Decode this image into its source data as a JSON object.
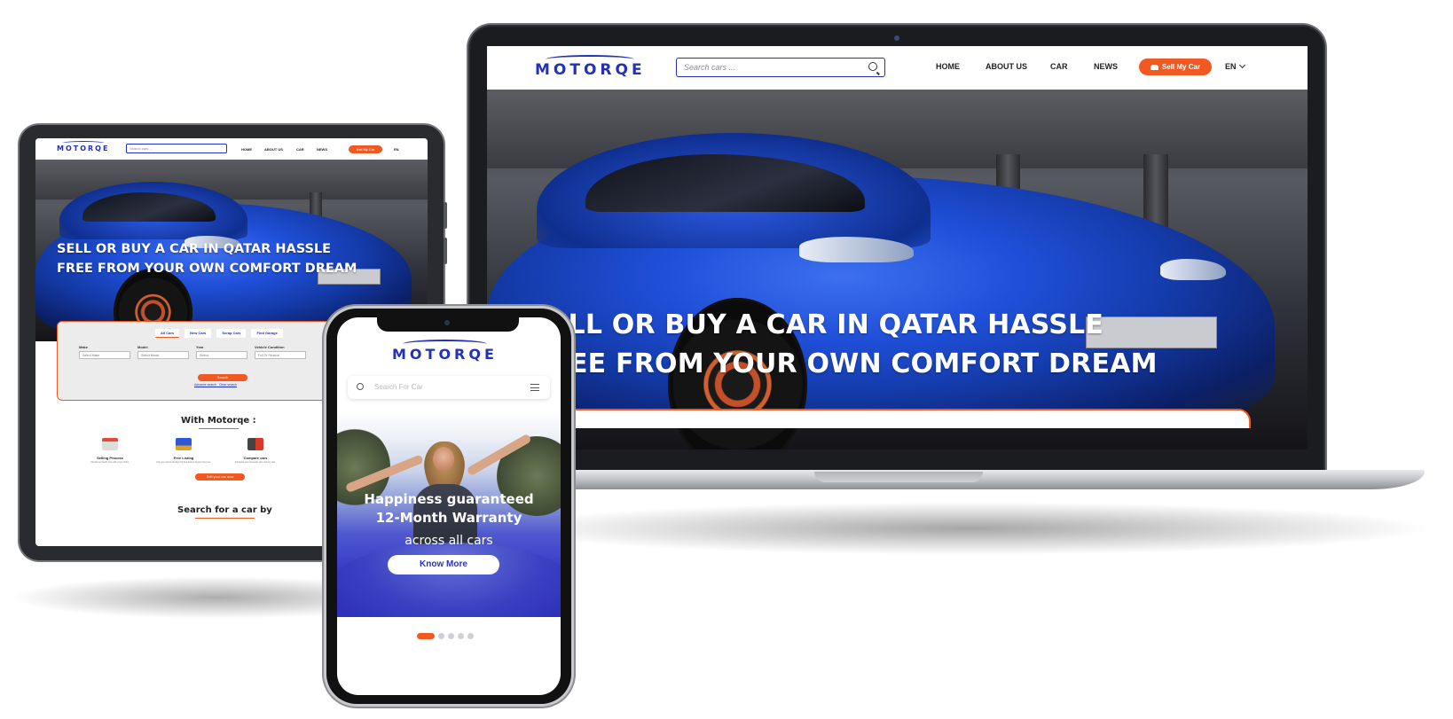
{
  "brand": {
    "name": "MOTORQE",
    "accent": "#f05a22",
    "primary": "#2232b8"
  },
  "laptop": {
    "search_placeholder": "Search cars ...",
    "nav": [
      "HOME",
      "ABOUT US",
      "CAR",
      "NEWS"
    ],
    "sell_label": "Sell My Car",
    "lang": "EN",
    "headline_line1": "SELL OR BUY A CAR IN QATAR HASSLE",
    "headline_line2": "FREE FROM YOUR OWN COMFORT DREAM"
  },
  "tablet": {
    "search_placeholder": "Search cars ...",
    "nav": [
      "HOME",
      "ABOUT US",
      "CAR",
      "NEWS"
    ],
    "sell_label": "Sell My Car",
    "lang": "EN",
    "headline_line1": "SELL OR BUY A CAR IN QATAR HASSLE",
    "headline_line2": "FREE FROM YOUR OWN COMFORT DREAM",
    "tabs": [
      "All Cars",
      "New Cars",
      "Scrap Cars",
      "Find Garage"
    ],
    "fields": [
      {
        "label": "Make",
        "value": "Select Make"
      },
      {
        "label": "Model",
        "value": "Select Model"
      },
      {
        "label": "Year",
        "value": "Select"
      },
      {
        "label": "Vehicle Condition",
        "value": "Full Or Finance"
      }
    ],
    "search_button": "Search",
    "advance_search": "Advance search",
    "clear_search": "Clear search",
    "with_title": "With Motorqe :",
    "features": [
      {
        "name": "Selling Process",
        "desc": "Sell all our hands free with a few clicks."
      },
      {
        "name": "Free Listing",
        "desc": "List your car for all days for free and let buyers find you."
      },
      {
        "name": "Compare cars",
        "desc": "Compare your favourite cars side by side."
      }
    ],
    "sell_now": "Sell your car now",
    "search_by_title": "Search for a car by"
  },
  "phone": {
    "search_placeholder": "Search For Car",
    "banner_line1": "Happiness guaranteed",
    "banner_line2": "12-Month Warranty",
    "banner_line3": "across all cars",
    "cta": "Know More",
    "slides_total": 5,
    "slide_active": 1
  }
}
